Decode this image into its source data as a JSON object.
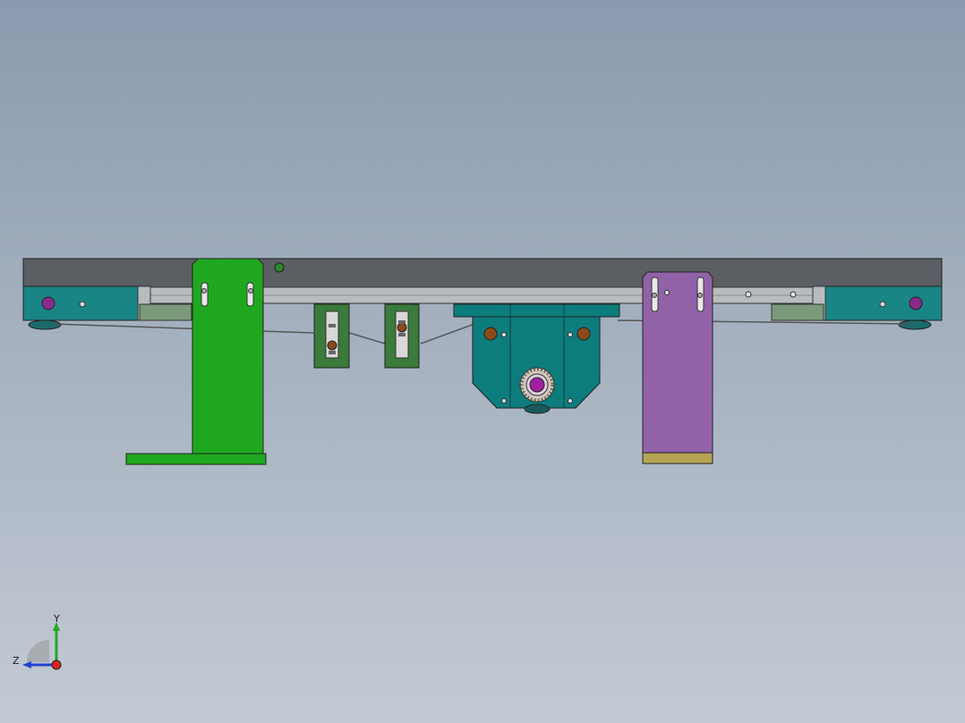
{
  "viewport": {
    "background_top": "#8b9aae",
    "background_bottom": "#c3cad4"
  },
  "model": {
    "colors": {
      "rail_top": "#5b5e62",
      "rail_bottom": "#b8bcbf",
      "end_block": "#1a8585",
      "green_bracket": "#1fa81f",
      "dark_green_bracket": "#3a7a3a",
      "teal_housing": "#0d7c7c",
      "purple_bracket": "#9162a8",
      "pad": "#b6a556",
      "bolt_brown": "#8b4a1a",
      "pulley_purple": "#a020a0"
    }
  },
  "triad": {
    "y_label": "Y",
    "z_label": "Z",
    "y_color": "#22aa22",
    "z_color": "#2244cc",
    "x_color": "#dd2222"
  }
}
